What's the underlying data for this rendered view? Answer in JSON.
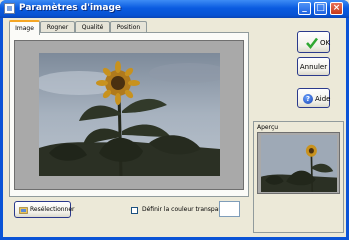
{
  "window": {
    "title": "Paramètres d'image"
  },
  "titlebar_buttons": {
    "minimize": "_",
    "maximize": "□",
    "close": "×"
  },
  "tabs": [
    {
      "label": "Image",
      "active": true
    },
    {
      "label": "Rogner",
      "active": false
    },
    {
      "label": "Qualité",
      "active": false
    },
    {
      "label": "Position",
      "active": false
    }
  ],
  "buttons": {
    "ok": "OK",
    "cancel": "Annuler",
    "help": "Aide",
    "help_symbol": "?",
    "reselect": "Resélectionner"
  },
  "preview": {
    "label": "Aperçu"
  },
  "options": {
    "transparent_color_label": "Définir la couleur transparente",
    "transparent_checked": false
  },
  "colors": {
    "titlebar": "#0a5be0",
    "ok_check": "#2fa833",
    "dialog_bg": "#ece9d8",
    "tab_highlight": "#f5a623"
  }
}
